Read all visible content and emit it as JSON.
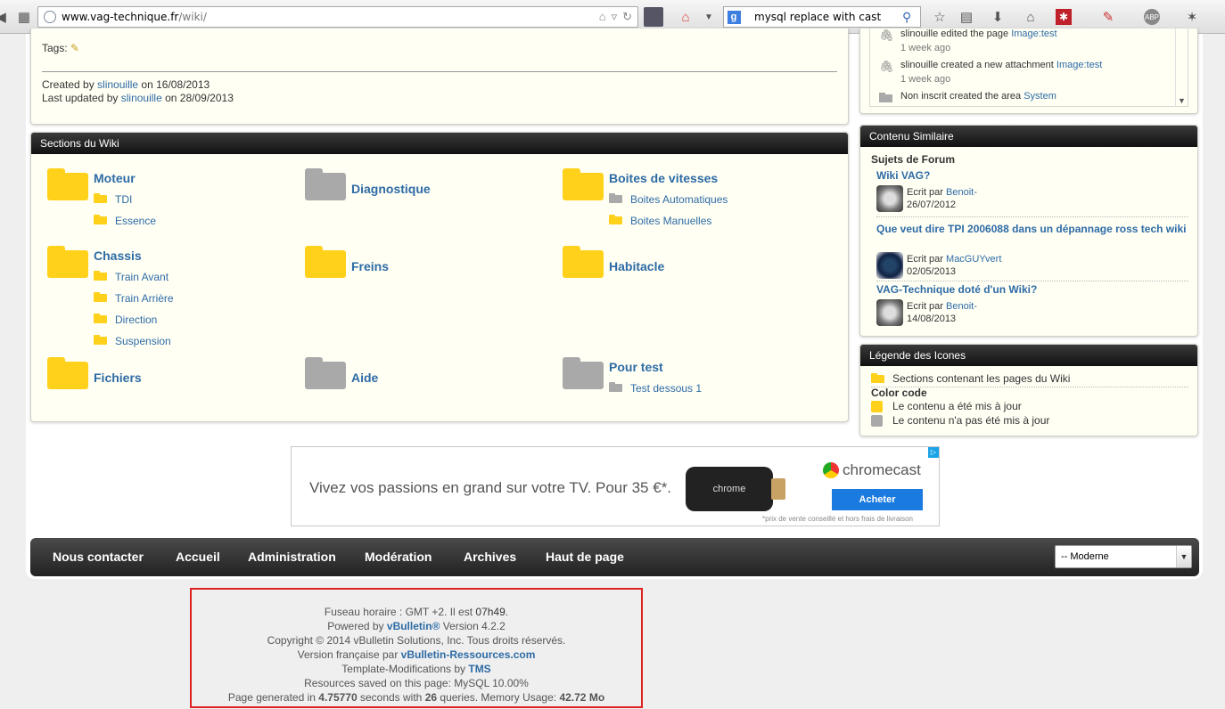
{
  "browser": {
    "url_host": "www.vag-technique.fr",
    "url_path": "/wiki/",
    "search_query": "mysql replace with cast",
    "search_engine_letter": "g"
  },
  "meta": {
    "tags_label": "Tags:",
    "created_prefix": "Created by",
    "created_user": "slinouille",
    "created_on": "on 16/08/2013",
    "updated_prefix": "Last updated by",
    "updated_user": "slinouille",
    "updated_on": "on 28/09/2013"
  },
  "sections": {
    "title": "Sections du Wiki",
    "items": [
      {
        "name": "Moteur",
        "color": "yellow",
        "subs": [
          {
            "name": "TDI",
            "color": "yellow"
          },
          {
            "name": "Essence",
            "color": "yellow"
          }
        ]
      },
      {
        "name": "Diagnostique",
        "color": "gray",
        "subs": []
      },
      {
        "name": "Boites de vitesses",
        "color": "yellow",
        "subs": [
          {
            "name": "Boites Automatiques",
            "color": "gray"
          },
          {
            "name": "Boites Manuelles",
            "color": "yellow"
          }
        ]
      },
      {
        "name": "Chassis",
        "color": "yellow",
        "subs": [
          {
            "name": "Train Avant",
            "color": "yellow"
          },
          {
            "name": "Train Arrière",
            "color": "yellow"
          },
          {
            "name": "Direction",
            "color": "yellow"
          },
          {
            "name": "Suspension",
            "color": "yellow"
          }
        ]
      },
      {
        "name": "Freins",
        "color": "yellow",
        "subs": []
      },
      {
        "name": "Habitacle",
        "color": "yellow",
        "subs": []
      },
      {
        "name": "Fichiers",
        "color": "yellow",
        "subs": []
      },
      {
        "name": "Aide",
        "color": "gray",
        "subs": []
      },
      {
        "name": "Pour test",
        "color": "gray",
        "subs": [
          {
            "name": "Test dessous 1",
            "color": "gray"
          }
        ]
      }
    ]
  },
  "activity": [
    {
      "user": "slinouille",
      "action": "edited the page",
      "target": "Image:test",
      "when": "1 week ago",
      "icon": "paperclip-icon"
    },
    {
      "user": "slinouille",
      "action": "created a new attachment",
      "target": "Image:test",
      "when": "1 week ago",
      "icon": "paperclip-icon"
    },
    {
      "user": "Non inscrit",
      "action": "created the area",
      "target": "System",
      "when": "",
      "icon": "folder-icon"
    }
  ],
  "similar": {
    "title": "Contenu Similaire",
    "subhead": "Sujets de Forum",
    "threads": [
      {
        "title": "Wiki VAG?",
        "by_label": "Ecrit par",
        "author": "Benoit-",
        "date": "26/07/2012"
      },
      {
        "title": "Que veut dire TPI 2006088 dans un dépannage ross tech wiki",
        "by_label": "Ecrit par",
        "author": "MacGUYvert",
        "date": "02/05/2013"
      },
      {
        "title": "VAG-Technique doté d'un Wiki?",
        "by_label": "Ecrit par",
        "author": "Benoit-",
        "date": "14/08/2013"
      }
    ]
  },
  "legend": {
    "title": "Légende des Icones",
    "sections_label": "Sections contenant les pages du Wiki",
    "color_code": "Color code",
    "updated": "Le contenu a été mis à jour",
    "not_updated": "Le contenu n'a pas été mis à jour"
  },
  "ad": {
    "slogan": "Vivez vos passions en grand sur votre TV.   Pour 35 €*.",
    "device_label": "chrome",
    "brand": "chromecast",
    "button": "Acheter",
    "fine_print": "*prix de vente conseillé et hors frais de livraison"
  },
  "navbar": {
    "links": [
      "Nous contacter",
      "Accueil",
      "Administration",
      "Modération",
      "Archives",
      "Haut de page"
    ],
    "style_select": "-- Moderne"
  },
  "footer": {
    "timezone_a": "Fuseau horaire : GMT +2. Il est ",
    "time": "07h49",
    "powered_a": "Powered by ",
    "powered_link": "vBulletin®",
    "powered_b": " Version 4.2.2",
    "copyright": "Copyright © 2014 vBulletin Solutions, Inc. Tous droits réservés.",
    "fr_a": "Version française par ",
    "fr_link": "vBulletin-Ressources.com",
    "tm_a": "Template-Modifications by ",
    "tm_link": "TMS",
    "resources": "Resources saved on this page: MySQL 10.00%",
    "gen_a": "Page generated in ",
    "gen_time": "4.75770",
    "gen_b": " seconds with ",
    "gen_q": "26",
    "gen_c": " queries. Memory Usage: ",
    "gen_mem": "42.72 Mo"
  },
  "colors": {
    "folder_yellow": "#ffd11a",
    "folder_gray": "#a9a9a9",
    "link": "#2e6ba5",
    "header_dark": "#1a1a1a",
    "highlight_border": "#dd2222"
  }
}
